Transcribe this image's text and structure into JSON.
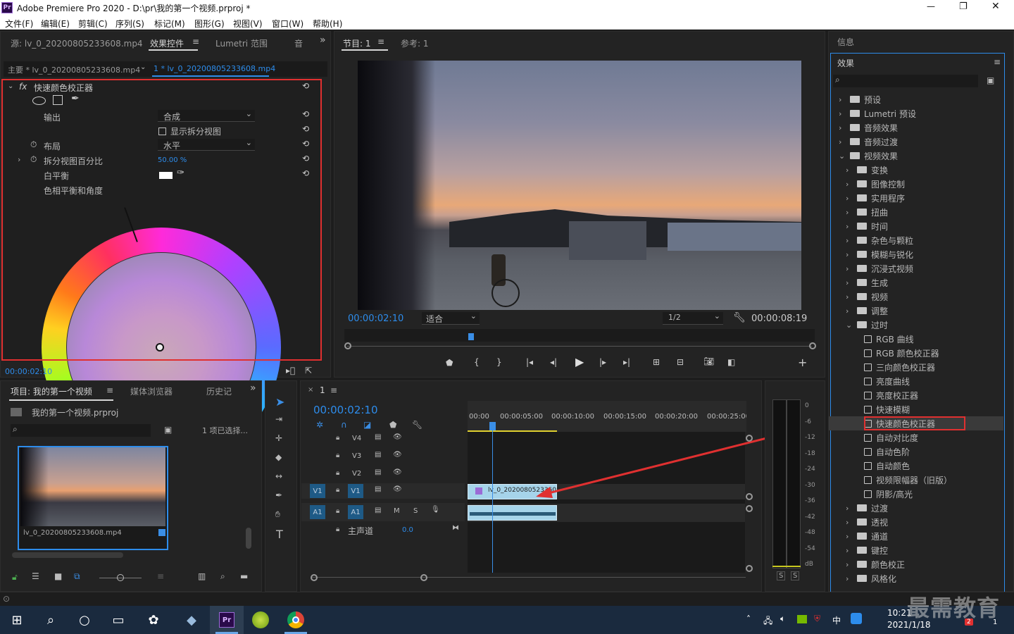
{
  "app": {
    "title": "Adobe Premiere Pro 2020 - D:\\pr\\我的第一个视频.prproj *",
    "logo": "Pr"
  },
  "window_controls": {
    "minimize": "—",
    "restore": "❐",
    "close": "✕"
  },
  "menu": [
    "文件(F)",
    "编辑(E)",
    "剪辑(C)",
    "序列(S)",
    "标记(M)",
    "图形(G)",
    "视图(V)",
    "窗口(W)",
    "帮助(H)"
  ],
  "source_panel": {
    "tabs": [
      "源: lv_0_20200805233608.mp4",
      "效果控件",
      "Lumetri 范围",
      "音"
    ],
    "active_tab": "效果控件",
    "master_label": "主要 * lv_0_20200805233608.mp4",
    "clip_label": "1 * lv_0_20200805233608.mp4",
    "effect_name": "快速颜色校正器",
    "fx_label": "fx",
    "output_label": "输出",
    "output_value": "合成",
    "show_split_label": "显示拆分视图",
    "layout_label": "布局",
    "layout_value": "水平",
    "split_pct_label": "拆分视图百分比",
    "split_pct_value": "50.00 %",
    "white_balance_label": "白平衡",
    "hue_label": "色相平衡和角度",
    "timecode": "00:00:02:10"
  },
  "program_panel": {
    "tabs": [
      "节目: 1",
      "参考: 1"
    ],
    "timecode": "00:00:02:10",
    "fit": "适合",
    "resolution": "1/2",
    "duration": "00:00:08:19"
  },
  "project_panel": {
    "tabs": [
      "项目: 我的第一个视频",
      "媒体浏览器",
      "历史记"
    ],
    "file": "我的第一个视频.prproj",
    "selection": "1 项已选择...",
    "clip_name": "lv_0_20200805233608.mp4"
  },
  "timeline": {
    "tab": "1",
    "timecode": "00:00:02:10",
    "ruler": [
      "00:00",
      "00:00:05:00",
      "00:00:10:00",
      "00:00:15:00",
      "00:00:20:00",
      "00:00:25:00"
    ],
    "video_tracks": [
      "V4",
      "V3",
      "V2",
      "V1"
    ],
    "audio_tracks": [
      "A1"
    ],
    "src_v": "V1",
    "src_a": "A1",
    "mix_label": "主声道",
    "mix_value": "0.0",
    "clip_label": "lv_0_20200805233608",
    "m": "M",
    "s": "S"
  },
  "meter": {
    "scale": [
      "0",
      "-6",
      "-12",
      "-18",
      "-24",
      "-30",
      "-36",
      "-42",
      "-48",
      "-54",
      "dB"
    ],
    "s1": "S",
    "s2": "S"
  },
  "effects_panel": {
    "info_label": "信息",
    "title": "效果",
    "tree": [
      {
        "label": "预设",
        "level": 0,
        "type": "folder"
      },
      {
        "label": "Lumetri 预设",
        "level": 0,
        "type": "folder"
      },
      {
        "label": "音频效果",
        "level": 0,
        "type": "folder"
      },
      {
        "label": "音频过渡",
        "level": 0,
        "type": "folder"
      },
      {
        "label": "视频效果",
        "level": 0,
        "type": "folder",
        "open": true
      },
      {
        "label": "变换",
        "level": 1,
        "type": "folder"
      },
      {
        "label": "图像控制",
        "level": 1,
        "type": "folder"
      },
      {
        "label": "实用程序",
        "level": 1,
        "type": "folder"
      },
      {
        "label": "扭曲",
        "level": 1,
        "type": "folder"
      },
      {
        "label": "时间",
        "level": 1,
        "type": "folder"
      },
      {
        "label": "杂色与颗粒",
        "level": 1,
        "type": "folder"
      },
      {
        "label": "模糊与锐化",
        "level": 1,
        "type": "folder"
      },
      {
        "label": "沉浸式视频",
        "level": 1,
        "type": "folder"
      },
      {
        "label": "生成",
        "level": 1,
        "type": "folder"
      },
      {
        "label": "视频",
        "level": 1,
        "type": "folder"
      },
      {
        "label": "调整",
        "level": 1,
        "type": "folder"
      },
      {
        "label": "过时",
        "level": 1,
        "type": "folder",
        "open": true
      },
      {
        "label": "RGB 曲线",
        "level": 2,
        "type": "fx"
      },
      {
        "label": "RGB 颜色校正器",
        "level": 2,
        "type": "fx"
      },
      {
        "label": "三向颜色校正器",
        "level": 2,
        "type": "fx"
      },
      {
        "label": "亮度曲线",
        "level": 2,
        "type": "fx"
      },
      {
        "label": "亮度校正器",
        "level": 2,
        "type": "fx"
      },
      {
        "label": "快速模糊",
        "level": 2,
        "type": "fx"
      },
      {
        "label": "快速颜色校正器",
        "level": 2,
        "type": "fx",
        "selected": true
      },
      {
        "label": "自动对比度",
        "level": 2,
        "type": "fx"
      },
      {
        "label": "自动色阶",
        "level": 2,
        "type": "fx"
      },
      {
        "label": "自动颜色",
        "level": 2,
        "type": "fx"
      },
      {
        "label": "视频限幅器（旧版）",
        "level": 2,
        "type": "fx"
      },
      {
        "label": "阴影/高光",
        "level": 2,
        "type": "fx"
      },
      {
        "label": "过渡",
        "level": 1,
        "type": "folder"
      },
      {
        "label": "透视",
        "level": 1,
        "type": "folder"
      },
      {
        "label": "通道",
        "level": 1,
        "type": "folder"
      },
      {
        "label": "键控",
        "level": 1,
        "type": "folder"
      },
      {
        "label": "颜色校正",
        "level": 1,
        "type": "folder"
      },
      {
        "label": "风格化",
        "level": 1,
        "type": "folder"
      }
    ]
  },
  "taskbar": {
    "time": "10:21",
    "date": "2021/1/18",
    "ime": "中",
    "notif": "2",
    "badge": "1"
  },
  "watermark": "最需教育",
  "colors": {
    "accent": "#2d8ceb",
    "highlight": "#e03030",
    "bg": "#232323"
  }
}
